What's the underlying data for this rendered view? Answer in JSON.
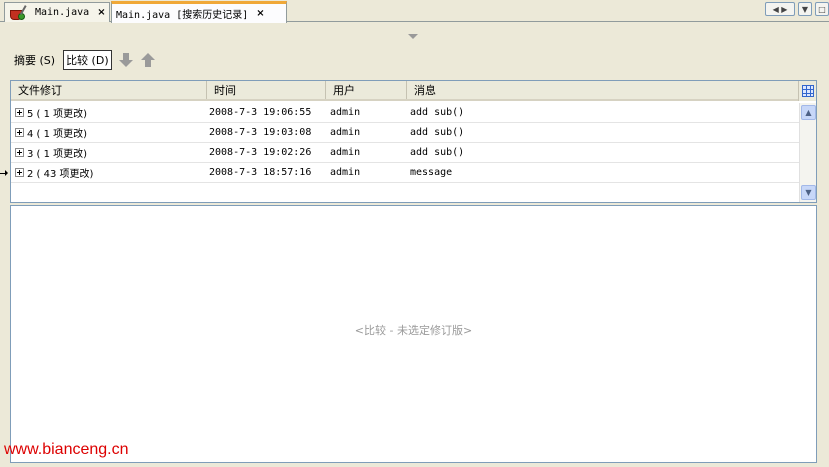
{
  "tabs": [
    {
      "label": "Main.java",
      "close": "×"
    },
    {
      "label": "Main.java [搜索历史记录]",
      "close": "×"
    }
  ],
  "toolbar": {
    "summary_label": "摘要 (S)",
    "compare_label": "比较 (D)"
  },
  "table": {
    "columns": [
      "文件修订",
      "时间",
      "用户",
      "消息"
    ],
    "rows": [
      {
        "revision": "5 ( 1 项更改)",
        "time": "2008-7-3 19:06:55",
        "user": "admin",
        "message": "add sub()"
      },
      {
        "revision": "4 ( 1 项更改)",
        "time": "2008-7-3 19:03:08",
        "user": "admin",
        "message": "add sub()"
      },
      {
        "revision": "3 ( 1 项更改)",
        "time": "2008-7-3 19:02:26",
        "user": "admin",
        "message": "add sub()"
      },
      {
        "revision": "2 ( 43 项更改)",
        "time": "2008-7-3 18:57:16",
        "user": "admin",
        "message": "message"
      }
    ]
  },
  "diff": {
    "placeholder": "<比较 - 未选定修订版>"
  },
  "watermark": "www.bianceng.cn",
  "colors": {
    "active_tab_accent": "#f0a838",
    "watermark": "#dd0000"
  }
}
